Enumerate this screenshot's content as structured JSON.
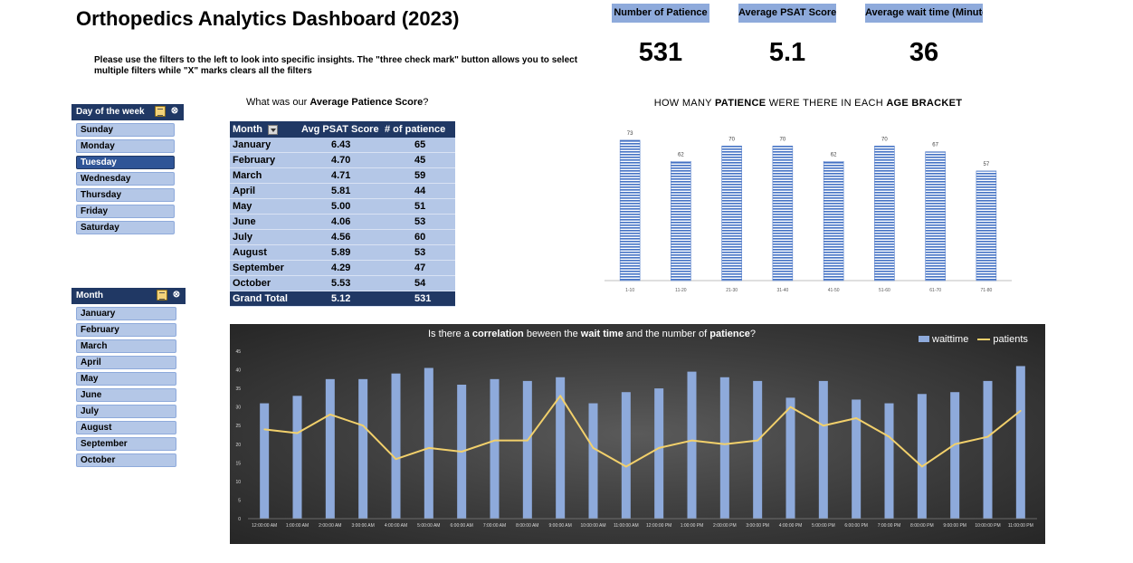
{
  "title": "Orthopedics Analytics Dashboard (2023)",
  "instructions": "Please use the filters to the left to look into specific insights. The \"three check mark\" button allows you to select multiple filters while \"X\" marks clears all the filters",
  "kpis": [
    {
      "label": "Number of Patience",
      "value": "531"
    },
    {
      "label": "Average PSAT Score",
      "value": "5.1"
    },
    {
      "label": "Average wait time (Minutes)",
      "value": "36"
    }
  ],
  "slicer_day": {
    "title": "Day of the week",
    "items": [
      "Sunday",
      "Monday",
      "Tuesday",
      "Wednesday",
      "Thursday",
      "Friday",
      "Saturday"
    ],
    "selected": "Tuesday"
  },
  "slicer_month": {
    "title": "Month",
    "items": [
      "January",
      "February",
      "March",
      "April",
      "May",
      "June",
      "July",
      "August",
      "September",
      "October"
    ]
  },
  "pivot": {
    "caption_pre": "What was our ",
    "caption_bold": "Average Patience Score",
    "caption_post": "?",
    "headers": [
      "Month",
      "Avg PSAT Score",
      "# of patience"
    ],
    "rows": [
      [
        "January",
        "6.43",
        "65"
      ],
      [
        "February",
        "4.70",
        "45"
      ],
      [
        "March",
        "4.71",
        "59"
      ],
      [
        "April",
        "5.81",
        "44"
      ],
      [
        "May",
        "5.00",
        "51"
      ],
      [
        "June",
        "4.06",
        "53"
      ],
      [
        "July",
        "4.56",
        "60"
      ],
      [
        "August",
        "5.89",
        "53"
      ],
      [
        "September",
        "4.29",
        "47"
      ],
      [
        "October",
        "5.53",
        "54"
      ]
    ],
    "total": [
      "Grand Total",
      "5.12",
      "531"
    ]
  },
  "chart_data": [
    {
      "type": "bar",
      "title": "HOW MANY PATIENCE WERE THERE IN EACH AGE BRACKET",
      "title_parts": [
        "HOW MANY ",
        "PATIENCE",
        " WERE THERE IN EACH ",
        "AGE BRACKET"
      ],
      "categories": [
        "1-10",
        "11-20",
        "21-30",
        "31-40",
        "41-50",
        "51-60",
        "61-70",
        "71-80"
      ],
      "values": [
        73,
        62,
        70,
        70,
        62,
        70,
        67,
        57
      ],
      "ylim": [
        0,
        80
      ],
      "grid": false,
      "data_labels": true,
      "bar_color": "#4472c4"
    },
    {
      "type": "bar",
      "title": "Is there a correlation beween the wait time and the number of patience?",
      "title_parts": [
        "Is there a ",
        "correlation",
        " beween the ",
        "wait time",
        " and the number of ",
        "patience",
        "?"
      ],
      "categories": [
        "12:00:00 AM",
        "1:00:00 AM",
        "2:00:00 AM",
        "3:00:00 AM",
        "4:00:00 AM",
        "5:00:00 AM",
        "6:00:00 AM",
        "7:00:00 AM",
        "8:00:00 AM",
        "9:00:00 AM",
        "10:00:00 AM",
        "11:00:00 AM",
        "12:00:00 PM",
        "1:00:00 PM",
        "2:00:00 PM",
        "3:00:00 PM",
        "4:00:00 PM",
        "5:00:00 PM",
        "6:00:00 PM",
        "7:00:00 PM",
        "8:00:00 PM",
        "9:00:00 PM",
        "10:00:00 PM",
        "11:00:00 PM"
      ],
      "series": [
        {
          "name": "waittime",
          "type": "bar",
          "color": "#8eaadb",
          "values": [
            31,
            33,
            37.5,
            37.5,
            39,
            40.5,
            36,
            37.5,
            37,
            38,
            31,
            34,
            35,
            39.5,
            38,
            37,
            32.5,
            37,
            32,
            31,
            33.5,
            34,
            37,
            41
          ]
        },
        {
          "name": "patients",
          "type": "line",
          "color": "#f2d06b",
          "values": [
            24,
            23,
            28,
            25,
            16,
            19,
            18,
            21,
            21,
            33,
            19,
            14,
            19,
            21,
            20,
            21,
            30,
            25,
            27,
            22,
            14,
            20,
            22,
            29
          ]
        }
      ],
      "yticks": [
        0,
        5,
        10,
        15,
        20,
        25,
        30,
        35,
        40,
        45
      ],
      "ylim": [
        0,
        45
      ],
      "legend": "top-right",
      "grid": false,
      "background": "dark"
    }
  ]
}
